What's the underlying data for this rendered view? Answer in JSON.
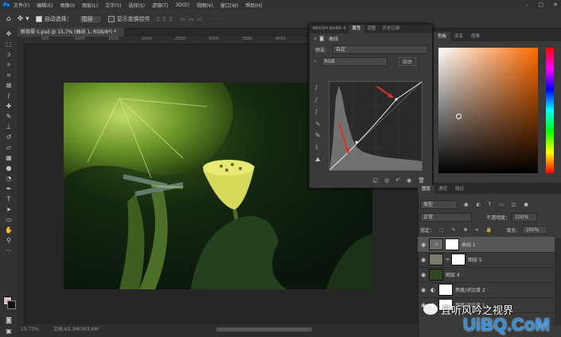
{
  "app": {
    "logo": "Ps"
  },
  "menu": [
    "文件(F)",
    "编辑(E)",
    "图像(I)",
    "图层(L)",
    "文字(Y)",
    "选择(S)",
    "滤镜(T)",
    "3D(D)",
    "视图(V)",
    "窗口(W)",
    "帮助(H)"
  ],
  "options_bar": {
    "auto_select_label": "自动选择：",
    "auto_select_value": "图层",
    "show_transform_label": "显示变换控件"
  },
  "document": {
    "tab_title": "新荷翠·1.psd @ 15.7% (曲线 1, RGB/8*) *"
  },
  "ruler_ticks": [
    "500",
    "1000",
    "1500",
    "2000",
    "2500",
    "3000",
    "3500",
    "4000",
    "4500",
    "5000",
    "5500"
  ],
  "status": {
    "zoom": "15.73%",
    "doc_size": "文档:63.3M/303.6M"
  },
  "properties": {
    "tabs": [
      "BRUSH BANK 4",
      "属性",
      "调整",
      "历史记录"
    ],
    "active_tab": "属性",
    "title": "曲线",
    "preset_label": "预设：",
    "preset_value": "自定",
    "channel_value": "RGB",
    "auto_label": "自动"
  },
  "right_top_tabs": [
    "色板",
    "渐变",
    "图案"
  ],
  "color": {
    "accent": "#ff6a00"
  },
  "layers_panel": {
    "tabs": [
      "图层",
      "通道",
      "路径"
    ],
    "kind_filter": "类型",
    "blend_mode": "正常",
    "opacity_label": "不透明度：",
    "opacity_value": "100%",
    "lock_label": "锁定：",
    "fill_label": "填充：",
    "fill_value": "100%",
    "layers": [
      {
        "name": "曲线 1",
        "selected": true,
        "type": "curves"
      },
      {
        "name": "图层 5",
        "selected": false,
        "type": "pixel"
      },
      {
        "name": "图层 4",
        "selected": false,
        "type": "pixel"
      },
      {
        "name": "亮度/对比度 2",
        "selected": false,
        "type": "adjust"
      },
      {
        "name": "亮度/对比度 1",
        "selected": false,
        "type": "adjust"
      }
    ]
  },
  "watermark": {
    "text": "且听风吟之视界",
    "site": "UiBQ.CoM"
  }
}
